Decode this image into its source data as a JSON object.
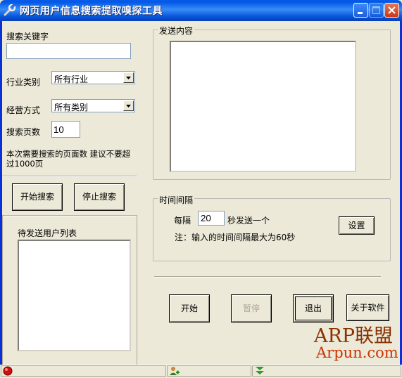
{
  "window": {
    "title": "网页用户信息搜索提取嗅探工具",
    "app_icon": "wrench-icon",
    "controls": [
      "minimize-icon",
      "maximize-icon",
      "close-icon"
    ]
  },
  "search": {
    "keyword_label": "搜索关键字",
    "keyword_value": "",
    "industry_label": "行业类别",
    "industry_selected": "所有行业",
    "business_label": "经营方式",
    "business_selected": "所有类别",
    "pages_label": "搜索页数",
    "pages_value": "10",
    "hint": "本次需要搜索的页面数 建议不要超过1000页",
    "start_button": "开始搜索",
    "stop_button": "停止搜索"
  },
  "pending_users": {
    "label": "待发送用户列表",
    "items": []
  },
  "send_content": {
    "group_title": "发送内容",
    "text": ""
  },
  "interval": {
    "group_title": "时间间隔",
    "every_label": "每隔",
    "value": "20",
    "unit_label": "秒发送一个",
    "note": "注：输入的时间间隔最大为60秒",
    "set_button": "设置"
  },
  "actions": {
    "start": "开始",
    "pause": "暂停",
    "pause_enabled": false,
    "exit": "退出",
    "about": "关于软件"
  },
  "statusbar": {
    "icons": [
      "red-status-light-icon",
      "user-add-icon",
      "green-double-arrow-icon"
    ]
  },
  "watermark": {
    "main": "ARP联盟",
    "url": "Arpun.com"
  },
  "colors": {
    "titlebar": "#0058e6",
    "window_bg": "#ece9d8",
    "watermark_main": "#8a3200",
    "watermark_url": "#cc3300"
  }
}
